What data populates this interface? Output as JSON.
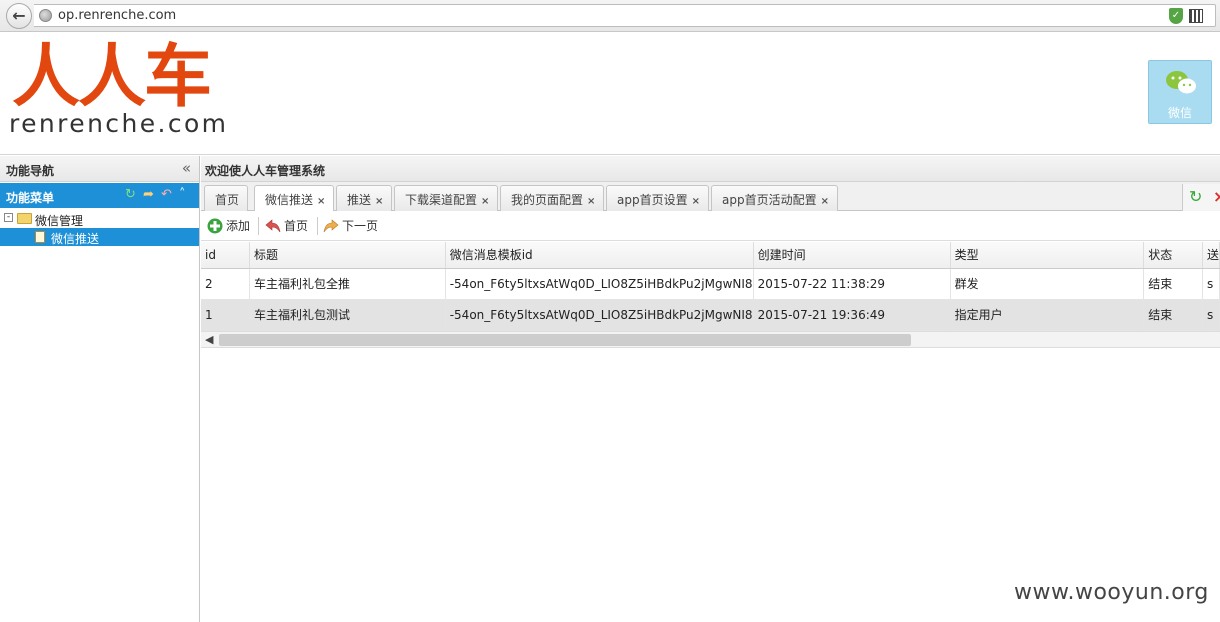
{
  "browser": {
    "url": "op.renrenche.com"
  },
  "header": {
    "logo_chinese": "人人车",
    "logo_text": "renrenche.com",
    "wechat_label": "微信"
  },
  "sidebar": {
    "nav_title": "功能导航",
    "menu_title": "功能菜单",
    "tree": [
      {
        "label": "微信管理"
      },
      {
        "label": "微信推送"
      }
    ]
  },
  "main": {
    "welcome": "欢迎使人人车管理系统",
    "tabs": [
      {
        "label": "首页",
        "closable": false
      },
      {
        "label": "微信推送",
        "closable": true,
        "active": true
      },
      {
        "label": "推送",
        "closable": true
      },
      {
        "label": "下载渠道配置",
        "closable": true
      },
      {
        "label": "我的页面配置",
        "closable": true
      },
      {
        "label": "app首页设置",
        "closable": true
      },
      {
        "label": "app首页活动配置",
        "closable": true
      }
    ],
    "toolbar": {
      "add": "添加",
      "first": "首页",
      "next": "下一页"
    },
    "grid": {
      "columns": [
        "id",
        "标题",
        "微信消息模板id",
        "创建时间",
        "类型",
        "状态",
        "送"
      ],
      "rows": [
        [
          "2",
          "车主福利礼包全推",
          "-54on_F6ty5ltxsAtWq0D_LIO8Z5iHBdkPu2jMgwNI8",
          "2015-07-22 11:38:29",
          "群发",
          "结束",
          "s"
        ],
        [
          "1",
          "车主福利礼包测试",
          "-54on_F6ty5ltxsAtWq0D_LIO8Z5iHBdkPu2jMgwNI8",
          "2015-07-21 19:36:49",
          "指定用户",
          "结束",
          "s"
        ]
      ]
    }
  },
  "watermark": "www.wooyun.org",
  "colors": {
    "brand": "#e2470f",
    "menu_blue": "#1e90d8"
  }
}
